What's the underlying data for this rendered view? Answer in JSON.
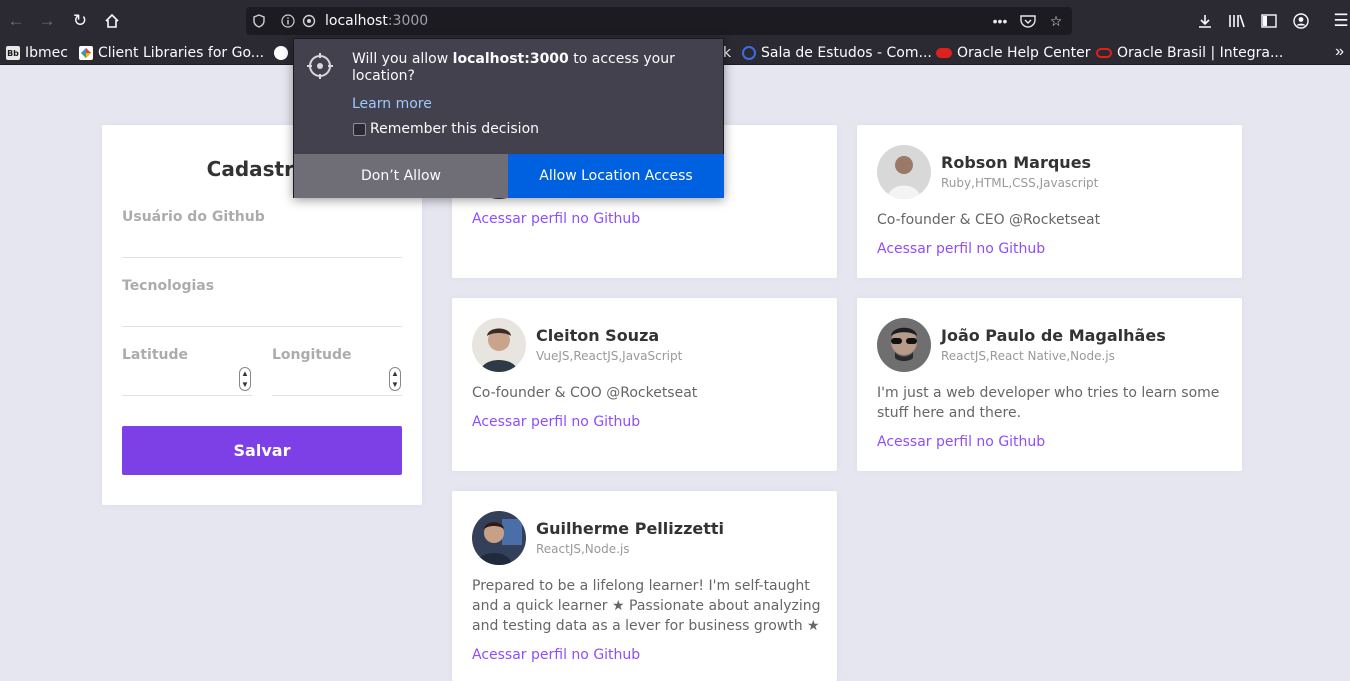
{
  "browser": {
    "url_host": "localhost",
    "url_port": ":3000",
    "bookmarks": [
      {
        "label": "Ibmec",
        "icon": "blackboard-icon",
        "color": "#1c1c1c"
      },
      {
        "label": "Client Libraries for Go...",
        "icon": "google-cloud-icon",
        "color": "#4285f4"
      },
      {
        "label": "Sala de Estudos - Com...",
        "icon": "circle-icon",
        "color": "#3b6de0"
      },
      {
        "label": "Oracle Help Center",
        "icon": "oracle-icon",
        "color": "#e0201b"
      },
      {
        "label": "Oracle Brasil | Integra...",
        "icon": "oracle-icon",
        "color": "#e0201b"
      }
    ],
    "bookmark_fragment": "k"
  },
  "popup": {
    "message_prefix": "Will you allow ",
    "message_host": "localhost:3000",
    "message_suffix": " to access your location?",
    "learn_more": "Learn more",
    "remember_label": "Remember this decision",
    "deny_label": "Don’t Allow",
    "allow_label": "Allow Location Access"
  },
  "form": {
    "title": "Cadastrar",
    "github_label": "Usuário do Github",
    "techs_label": "Tecnologias",
    "latitude_label": "Latitude",
    "longitude_label": "Longitude",
    "save_label": "Salvar"
  },
  "devs": [
    {
      "name": "",
      "techs": "",
      "bio": "",
      "link": "Acessar perfil no Github"
    },
    {
      "name": "Robson Marques",
      "techs": "Ruby,HTML,CSS,Javascript",
      "bio": "Co-founder & CEO @Rocketseat",
      "link": "Acessar perfil no Github"
    },
    {
      "name": "Cleiton Souza",
      "techs": "VueJS,ReactJS,JavaScript",
      "bio": "Co-founder & COO @Rocketseat",
      "link": "Acessar perfil no Github"
    },
    {
      "name": "João Paulo de Magalhães",
      "techs": "ReactJS,React Native,Node.js",
      "bio": "I'm just a web developer who tries to learn some stuff here and there.",
      "link": "Acessar perfil no Github"
    },
    {
      "name": "Guilherme Pellizzetti",
      "techs": "ReactJS,Node.js",
      "bio": "Prepared to be a lifelong learner! I'm self-taught and a quick learner ★ Passionate about analyzing and testing data as a lever for business growth ★",
      "link": "Acessar perfil no Github"
    }
  ],
  "colors": {
    "accent": "#7d40e7",
    "link": "#8e4dff",
    "page_bg": "#e6e6f0",
    "allow_button": "#0061e0"
  }
}
